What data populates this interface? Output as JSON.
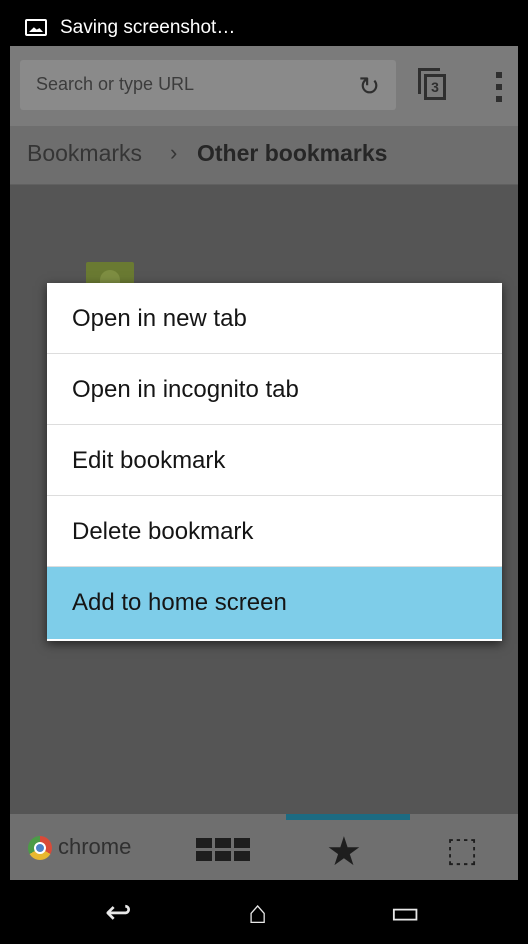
{
  "status_bar": {
    "text": "Saving screenshot…",
    "icon": "image-icon"
  },
  "toolbar": {
    "search_placeholder": "Search or type URL",
    "reload_icon": "↻",
    "tab_count": "3"
  },
  "breadcrumb": {
    "root": "Bookmarks",
    "separator": "›",
    "current": "Other bookmarks"
  },
  "context_menu": {
    "items": [
      {
        "label": "Open in new tab"
      },
      {
        "label": "Open in incognito tab"
      },
      {
        "label": "Edit bookmark"
      },
      {
        "label": "Delete bookmark"
      },
      {
        "label": "Add to home screen",
        "highlighted": true
      }
    ],
    "highlight_color": "#7ecde9"
  },
  "bottom_bar": {
    "chrome_label": "chrome",
    "star_glyph": "★",
    "recent_glyph": "⬚",
    "active_tab": "bookmarks",
    "accent": "#1d6b82"
  },
  "nav_bar": {
    "back_glyph": "↩",
    "home_glyph": "⌂",
    "recents_glyph": "▭"
  }
}
